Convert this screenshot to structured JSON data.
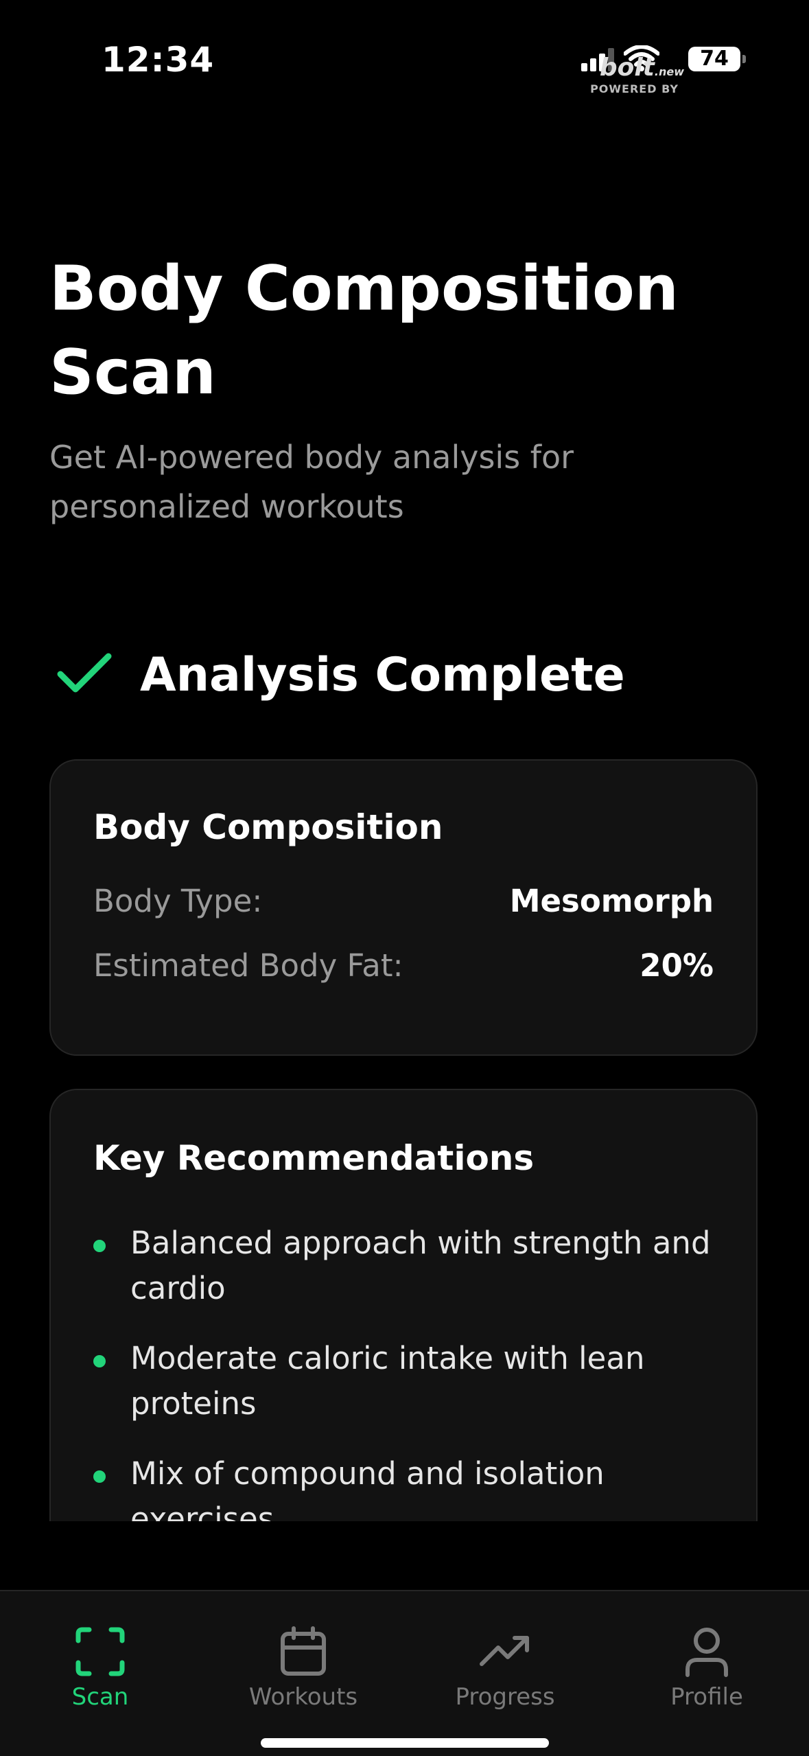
{
  "status_bar": {
    "time": "12:34",
    "battery": "74",
    "brand": "bolt",
    "brand_suffix": ".new",
    "powered_by": "POWERED BY"
  },
  "header": {
    "title": "Body Composition Scan",
    "subtitle": "Get AI-powered body analysis for personalized workouts"
  },
  "analysis": {
    "status_text": "Analysis Complete",
    "icon": "check-icon",
    "accent_color": "#22d47a"
  },
  "body_composition": {
    "title": "Body Composition",
    "rows": [
      {
        "label": "Body Type:",
        "value": "Mesomorph"
      },
      {
        "label": "Estimated Body Fat:",
        "value": "20%"
      }
    ]
  },
  "recommendations": {
    "title": "Key Recommendations",
    "items": [
      "Balanced approach with strength and cardio",
      "Moderate caloric intake with lean proteins",
      "Mix of compound and isolation exercises"
    ]
  },
  "tabbar": {
    "tabs": [
      {
        "label": "Scan",
        "icon": "scan-icon",
        "active": true
      },
      {
        "label": "Workouts",
        "icon": "calendar-icon",
        "active": false
      },
      {
        "label": "Progress",
        "icon": "trending-up-icon",
        "active": false
      },
      {
        "label": "Profile",
        "icon": "user-icon",
        "active": false
      }
    ]
  }
}
